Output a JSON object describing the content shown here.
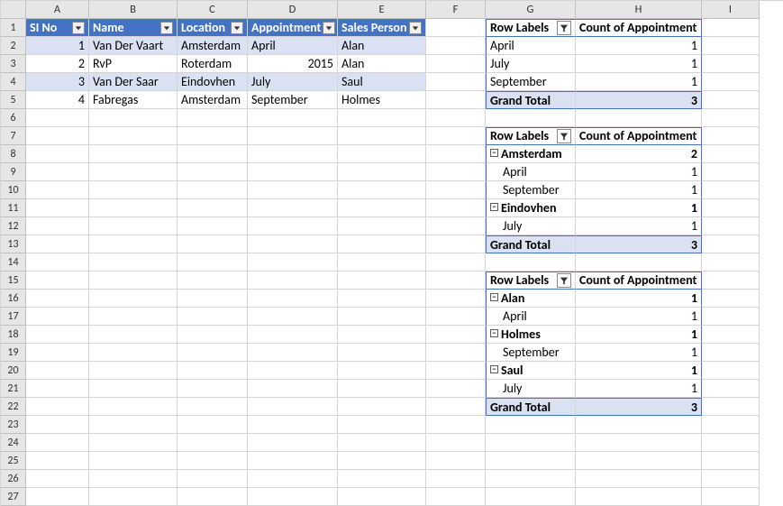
{
  "columns": [
    "A",
    "B",
    "C",
    "D",
    "E",
    "F",
    "G",
    "H",
    "I"
  ],
  "table": {
    "headers": {
      "a": "SI No",
      "b": "Name",
      "c": "Location",
      "d": "Appointment",
      "e": "Sales Person"
    },
    "rows": [
      {
        "a": "1",
        "b": "Van Der Vaart",
        "c": "Amsterdam",
        "d": "April",
        "e": "Alan"
      },
      {
        "a": "2",
        "b": "RvP",
        "c": "Roterdam",
        "d": "2015",
        "e": "Alan"
      },
      {
        "a": "3",
        "b": "Van Der Saar",
        "c": "Eindovhen",
        "d": "July",
        "e": "Saul"
      },
      {
        "a": "4",
        "b": "Fabregas",
        "c": "Amsterdam",
        "d": "September",
        "e": "Holmes"
      }
    ]
  },
  "pivot1": {
    "hdr_labels": "Row Labels",
    "hdr_count": "Count of Appointment",
    "rows": [
      {
        "label": "April",
        "val": "1"
      },
      {
        "label": "July",
        "val": "1"
      },
      {
        "label": "September",
        "val": "1"
      }
    ],
    "total_label": "Grand Total",
    "total_val": "3"
  },
  "pivot2": {
    "hdr_labels": "Row Labels",
    "hdr_count": "Count of Appointment",
    "groups": [
      {
        "parent": "Amsterdam",
        "pval": "2",
        "children": [
          {
            "label": "April",
            "val": "1"
          },
          {
            "label": "September",
            "val": "1"
          }
        ]
      },
      {
        "parent": "Eindovhen",
        "pval": "1",
        "children": [
          {
            "label": "July",
            "val": "1"
          }
        ]
      }
    ],
    "total_label": "Grand Total",
    "total_val": "3"
  },
  "pivot3": {
    "hdr_labels": "Row Labels",
    "hdr_count": "Count of Appointment",
    "groups": [
      {
        "parent": "Alan",
        "pval": "1",
        "children": [
          {
            "label": "April",
            "val": "1"
          }
        ]
      },
      {
        "parent": "Holmes",
        "pval": "1",
        "children": [
          {
            "label": "September",
            "val": "1"
          }
        ]
      },
      {
        "parent": "Saul",
        "pval": "1",
        "children": [
          {
            "label": "July",
            "val": "1"
          }
        ]
      }
    ],
    "total_label": "Grand Total",
    "total_val": "3"
  },
  "chart_data": [
    {
      "type": "table",
      "title": "Source data",
      "columns": [
        "SI No",
        "Name",
        "Location",
        "Appointment",
        "Sales Person"
      ],
      "rows": [
        [
          1,
          "Van Der Vaart",
          "Amsterdam",
          "April",
          "Alan"
        ],
        [
          2,
          "RvP",
          "Roterdam",
          2015,
          "Alan"
        ],
        [
          3,
          "Van Der Saar",
          "Eindovhen",
          "July",
          "Saul"
        ],
        [
          4,
          "Fabregas",
          "Amsterdam",
          "September",
          "Holmes"
        ]
      ]
    },
    {
      "type": "table",
      "title": "Pivot: Count of Appointment by Appointment",
      "columns": [
        "Row Labels",
        "Count of Appointment"
      ],
      "rows": [
        [
          "April",
          1
        ],
        [
          "July",
          1
        ],
        [
          "September",
          1
        ],
        [
          "Grand Total",
          3
        ]
      ]
    },
    {
      "type": "table",
      "title": "Pivot: Count of Appointment by Location → Appointment",
      "columns": [
        "Row Labels",
        "Count of Appointment"
      ],
      "rows": [
        [
          "Amsterdam",
          2
        ],
        [
          "  April",
          1
        ],
        [
          "  September",
          1
        ],
        [
          "Eindovhen",
          1
        ],
        [
          "  July",
          1
        ],
        [
          "Grand Total",
          3
        ]
      ]
    },
    {
      "type": "table",
      "title": "Pivot: Count of Appointment by Sales Person → Appointment",
      "columns": [
        "Row Labels",
        "Count of Appointment"
      ],
      "rows": [
        [
          "Alan",
          1
        ],
        [
          "  April",
          1
        ],
        [
          "Holmes",
          1
        ],
        [
          "  September",
          1
        ],
        [
          "Saul",
          1
        ],
        [
          "  July",
          1
        ],
        [
          "Grand Total",
          3
        ]
      ]
    }
  ]
}
